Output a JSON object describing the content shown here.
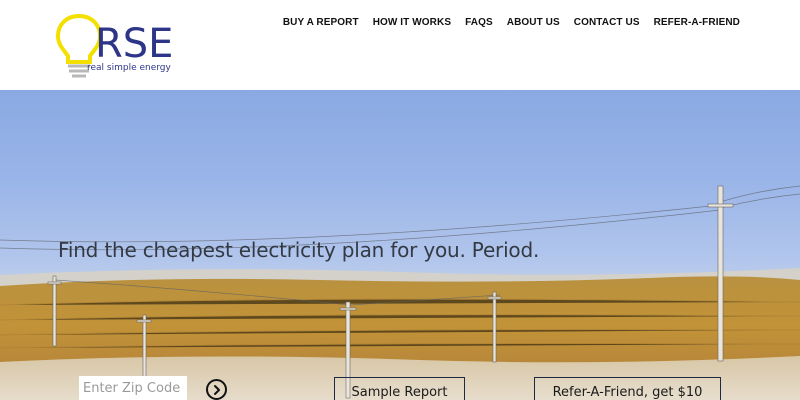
{
  "logo": {
    "text": "RSE",
    "tagline": "real simple energy",
    "accent_color": "#f4e000",
    "brand_color": "#2c3587"
  },
  "nav": {
    "items": [
      {
        "label": "BUY A REPORT"
      },
      {
        "label": "HOW IT WORKS"
      },
      {
        "label": "FAQS"
      },
      {
        "label": "ABOUT US"
      },
      {
        "label": "CONTACT US"
      },
      {
        "label": "REFER-A-FRIEND"
      }
    ]
  },
  "hero": {
    "headline": "Find the cheapest electricity plan for you. Period.",
    "zip_placeholder": "Enter Zip Code",
    "zip_value": "",
    "go_icon": "arrow-circle-right-icon",
    "sample_button": "Sample Report",
    "refer_button": "Refer-A-Friend, get $10"
  }
}
